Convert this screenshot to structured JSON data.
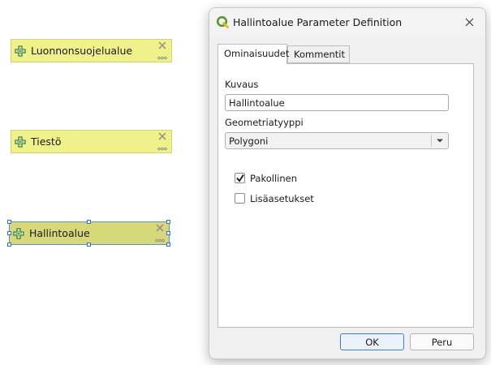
{
  "canvas": {
    "nodes": [
      {
        "label": "Luonnonsuojelualue",
        "selected": false
      },
      {
        "label": "Tiestö",
        "selected": false
      },
      {
        "label": "Hallintoalue",
        "selected": true
      }
    ]
  },
  "dialog": {
    "title": "Hallintoalue Parameter Definition",
    "tabs": [
      {
        "label": "Ominaisuudet",
        "active": true
      },
      {
        "label": "Kommentit",
        "active": false
      }
    ],
    "description_label": "Kuvaus",
    "description_value": "Hallintoalue",
    "geometry_type_label": "Geometriatyyppi",
    "geometry_type_value": "Polygoni",
    "mandatory_label": "Pakollinen",
    "mandatory_checked": true,
    "advanced_label": "Lisäasetukset",
    "advanced_checked": false,
    "ok_label": "OK",
    "cancel_label": "Peru"
  },
  "colors": {
    "node_fill": "#eff18b",
    "node_selected_fill": "#d6d87a",
    "selection_handle": "#2e6fd1",
    "qgis_green": "#589632",
    "qgis_yellow": "#eeb510"
  },
  "icons": {
    "node_add": "plus-icon",
    "node_remove": "close-icon",
    "node_more": "more-icon",
    "app": "qgis-logo-icon",
    "dropdown": "chevron-down-icon",
    "check": "checkmark-icon"
  }
}
